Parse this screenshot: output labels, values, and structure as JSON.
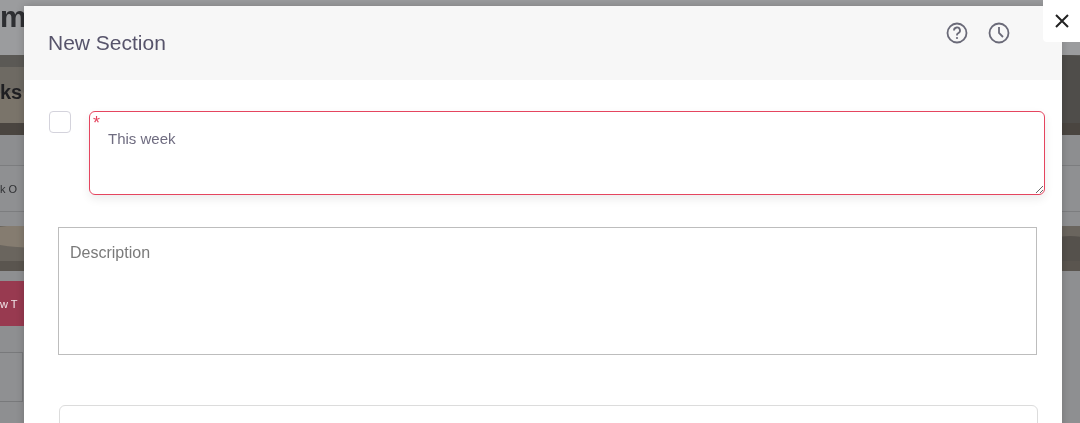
{
  "background": {
    "logo": "m",
    "heading": "ks",
    "filter_text": "k O",
    "button": "w T"
  },
  "dialog": {
    "title": "New Section",
    "checkbox": {
      "checked": false
    },
    "name_field": {
      "required_mark": "*",
      "value": "This week"
    },
    "description_field": {
      "placeholder": "Description"
    }
  }
}
